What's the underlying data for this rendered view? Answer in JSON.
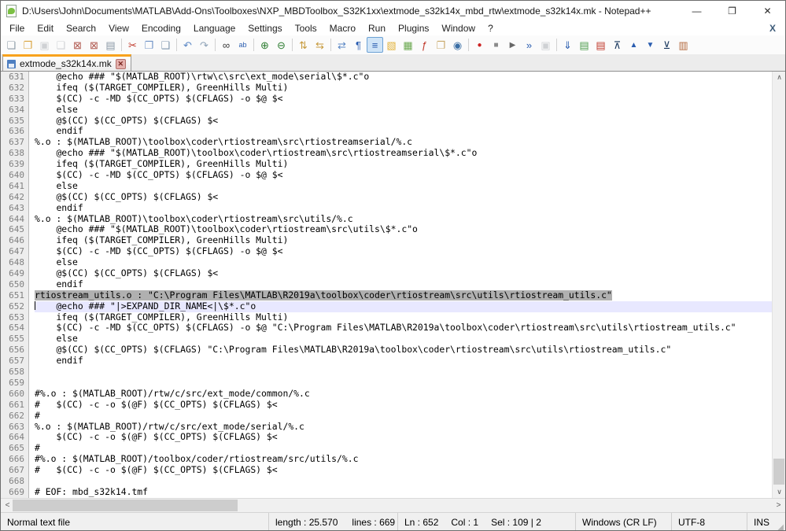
{
  "window": {
    "title": "D:\\Users\\John\\Documents\\MATLAB\\Add-Ons\\Toolboxes\\NXP_MBDToolbox_S32K1xx\\extmode_s32k14x_mbd_rtw\\extmode_s32k14x.mk - Notepad++",
    "controls": {
      "minimize": "—",
      "maximize": "❐",
      "close": "✕"
    }
  },
  "menu": {
    "items": [
      "File",
      "Edit",
      "Search",
      "View",
      "Encoding",
      "Language",
      "Settings",
      "Tools",
      "Macro",
      "Run",
      "Plugins",
      "Window",
      "?"
    ],
    "close_document_x": "X"
  },
  "toolbar": {
    "icons": [
      {
        "name": "new-file-icon",
        "glyph": "❏",
        "color": "#8c9aa6"
      },
      {
        "name": "open-folder-icon",
        "glyph": "❐",
        "color": "#d9a43e"
      },
      {
        "name": "save-icon",
        "glyph": "▣",
        "color": "#7d9cc0",
        "grayed": true
      },
      {
        "name": "save-all-icon",
        "glyph": "❑",
        "color": "#7d9cc0",
        "grayed": true
      },
      {
        "name": "close-icon",
        "glyph": "⊠",
        "color": "#b0584f"
      },
      {
        "name": "close-all-icon",
        "glyph": "⊠",
        "color": "#b0584f"
      },
      {
        "name": "print-icon",
        "glyph": "▤",
        "color": "#8a98a5"
      },
      {
        "name": "cut-icon",
        "glyph": "✂",
        "color": "#c0392b",
        "sep": true
      },
      {
        "name": "copy-icon",
        "glyph": "❐",
        "color": "#6f93c6"
      },
      {
        "name": "paste-icon",
        "glyph": "❑",
        "color": "#7f96ad"
      },
      {
        "name": "undo-icon",
        "glyph": "↶",
        "color": "#5b87c5",
        "sep": true
      },
      {
        "name": "redo-icon",
        "glyph": "↷",
        "color": "#8fa3b8"
      },
      {
        "name": "find-icon",
        "glyph": "∞",
        "color": "#3a3a3a",
        "sep": true
      },
      {
        "name": "replace-icon",
        "glyph": "ab",
        "color": "#2a5db0",
        "fs": 9
      },
      {
        "name": "zoom-in-icon",
        "glyph": "⊕",
        "color": "#2e7d32",
        "sep": true
      },
      {
        "name": "zoom-out-icon",
        "glyph": "⊖",
        "color": "#2e7d32"
      },
      {
        "name": "sync-vertical-icon",
        "glyph": "⇅",
        "color": "#c79a3c",
        "sep": true
      },
      {
        "name": "sync-horizontal-icon",
        "glyph": "⇆",
        "color": "#c79a3c"
      },
      {
        "name": "word-wrap-icon",
        "glyph": "⇄",
        "color": "#5b87c5",
        "sep": true
      },
      {
        "name": "show-all-chars-icon",
        "glyph": "¶",
        "color": "#2a5db0"
      },
      {
        "name": "indent-guide-icon",
        "glyph": "≡",
        "color": "#2a5db0",
        "pressed": true
      },
      {
        "name": "document-map-icon",
        "glyph": "▧",
        "color": "#e2b33c"
      },
      {
        "name": "project-map-icon",
        "glyph": "▦",
        "color": "#6aa84f"
      },
      {
        "name": "function-list-icon",
        "glyph": "ƒ",
        "color": "#c0392b"
      },
      {
        "name": "folder-as-workspace-icon",
        "glyph": "❐",
        "color": "#c9a96a"
      },
      {
        "name": "monitoring-icon",
        "glyph": "◉",
        "color": "#3a6ea5"
      },
      {
        "name": "macro-record-icon",
        "glyph": "●",
        "color": "#cc2222",
        "fs": 10,
        "sep": true
      },
      {
        "name": "macro-stop-icon",
        "glyph": "■",
        "color": "#8a8a8a",
        "fs": 10
      },
      {
        "name": "macro-play-icon",
        "glyph": "▶",
        "color": "#676767",
        "fs": 10
      },
      {
        "name": "macro-run-multiple-icon",
        "glyph": "»",
        "color": "#2a5db0"
      },
      {
        "name": "macro-save-icon",
        "glyph": "▣",
        "color": "#7d9cc0",
        "grayed": true
      },
      {
        "name": "compare-set-first-icon",
        "glyph": "⇓",
        "color": "#2a5db0",
        "sep": true
      },
      {
        "name": "compare-icon",
        "glyph": "▤",
        "color": "#4f9d4f"
      },
      {
        "name": "compare-clear-icon",
        "glyph": "▤",
        "color": "#c0392b"
      },
      {
        "name": "compare-first-diff-icon",
        "glyph": "⊼",
        "color": "#17365d"
      },
      {
        "name": "compare-prev-diff-icon",
        "glyph": "▲",
        "color": "#2a5db0",
        "fs": 10
      },
      {
        "name": "compare-next-diff-icon",
        "glyph": "▼",
        "color": "#2a5db0",
        "fs": 10
      },
      {
        "name": "compare-last-diff-icon",
        "glyph": "⊻",
        "color": "#17365d"
      },
      {
        "name": "compare-nav-bar-icon",
        "glyph": "▥",
        "color": "#b3683c"
      }
    ]
  },
  "tabbar": {
    "tabs": [
      {
        "label": "extmode_s32k14x.mk",
        "active": true,
        "close_glyph": "✕"
      }
    ]
  },
  "editor": {
    "first_line_number": 631,
    "lines": [
      {
        "n": 631,
        "t": "\t@echo ### \"$(MATLAB_ROOT)\\rtw\\c\\src\\ext_mode\\serial\\$*.c\"o",
        "s": ""
      },
      {
        "n": 632,
        "t": "\tifeq ($(TARGET_COMPILER), GreenHills Multi)",
        "s": ""
      },
      {
        "n": 633,
        "t": "\t$(CC) -c -MD $(CC_OPTS) $(CFLAGS) -o $@ $<",
        "s": ""
      },
      {
        "n": 634,
        "t": "\telse",
        "s": ""
      },
      {
        "n": 635,
        "t": "\t@$(CC) $(CC_OPTS) $(CFLAGS) $<",
        "s": ""
      },
      {
        "n": 636,
        "t": "\tendif",
        "s": ""
      },
      {
        "n": 637,
        "t": "%.o : $(MATLAB_ROOT)\\toolbox\\coder\\rtiostream\\src\\rtiostreamserial/%.c",
        "s": ""
      },
      {
        "n": 638,
        "t": "\t@echo ### \"$(MATLAB_ROOT)\\toolbox\\coder\\rtiostream\\src\\rtiostreamserial\\$*.c\"o",
        "s": ""
      },
      {
        "n": 639,
        "t": "\tifeq ($(TARGET_COMPILER), GreenHills Multi)",
        "s": ""
      },
      {
        "n": 640,
        "t": "\t$(CC) -c -MD $(CC_OPTS) $(CFLAGS) -o $@ $<",
        "s": ""
      },
      {
        "n": 641,
        "t": "\telse",
        "s": ""
      },
      {
        "n": 642,
        "t": "\t@$(CC) $(CC_OPTS) $(CFLAGS) $<",
        "s": ""
      },
      {
        "n": 643,
        "t": "\tendif",
        "s": ""
      },
      {
        "n": 644,
        "t": "%.o : $(MATLAB_ROOT)\\toolbox\\coder\\rtiostream\\src\\utils/%.c",
        "s": ""
      },
      {
        "n": 645,
        "t": "\t@echo ### \"$(MATLAB_ROOT)\\toolbox\\coder\\rtiostream\\src\\utils\\$*.c\"o",
        "s": ""
      },
      {
        "n": 646,
        "t": "\tifeq ($(TARGET_COMPILER), GreenHills Multi)",
        "s": ""
      },
      {
        "n": 647,
        "t": "\t$(CC) -c -MD $(CC_OPTS) $(CFLAGS) -o $@ $<",
        "s": ""
      },
      {
        "n": 648,
        "t": "\telse",
        "s": ""
      },
      {
        "n": 649,
        "t": "\t@$(CC) $(CC_OPTS) $(CFLAGS) $<",
        "s": ""
      },
      {
        "n": 650,
        "t": "\tendif",
        "s": ""
      },
      {
        "n": 651,
        "t": "rtiostream_utils.o : \"C:\\Program Files\\MATLAB\\R2019a\\toolbox\\coder\\rtiostream\\src\\utils\\rtiostream_utils.c\"",
        "s": "selected"
      },
      {
        "n": 652,
        "t": "\t@echo ### \"|>EXPAND_DIR_NAME<|\\$*.c\"o",
        "s": "current"
      },
      {
        "n": 653,
        "t": "\tifeq ($(TARGET_COMPILER), GreenHills Multi)",
        "s": ""
      },
      {
        "n": 654,
        "t": "\t$(CC) -c -MD $(CC_OPTS) $(CFLAGS) -o $@ \"C:\\Program Files\\MATLAB\\R2019a\\toolbox\\coder\\rtiostream\\src\\utils\\rtiostream_utils.c\"",
        "s": ""
      },
      {
        "n": 655,
        "t": "\telse",
        "s": ""
      },
      {
        "n": 656,
        "t": "\t@$(CC) $(CC_OPTS) $(CFLAGS) \"C:\\Program Files\\MATLAB\\R2019a\\toolbox\\coder\\rtiostream\\src\\utils\\rtiostream_utils.c\"",
        "s": ""
      },
      {
        "n": 657,
        "t": "\tendif",
        "s": ""
      },
      {
        "n": 658,
        "t": "",
        "s": ""
      },
      {
        "n": 659,
        "t": "",
        "s": ""
      },
      {
        "n": 660,
        "t": "#%.o : $(MATLAB_ROOT)/rtw/c/src/ext_mode/common/%.c",
        "s": ""
      },
      {
        "n": 661,
        "t": "#\t$(CC) -c -o $(@F) $(CC_OPTS) $(CFLAGS) $<",
        "s": ""
      },
      {
        "n": 662,
        "t": "#",
        "s": ""
      },
      {
        "n": 663,
        "t": "%.o : $(MATLAB_ROOT)/rtw/c/src/ext_mode/serial/%.c",
        "s": ""
      },
      {
        "n": 664,
        "t": "\t$(CC) -c -o $(@F) $(CC_OPTS) $(CFLAGS) $<",
        "s": ""
      },
      {
        "n": 665,
        "t": "#",
        "s": ""
      },
      {
        "n": 666,
        "t": "#%.o : $(MATLAB_ROOT)/toolbox/coder/rtiostream/src/utils/%.c",
        "s": ""
      },
      {
        "n": 667,
        "t": "#\t$(CC) -c -o $(@F) $(CC_OPTS) $(CFLAGS) $<",
        "s": ""
      },
      {
        "n": 668,
        "t": "",
        "s": ""
      },
      {
        "n": 669,
        "t": "# EOF: mbd_s32k14.tmf",
        "s": ""
      }
    ]
  },
  "scrollbars": {
    "up": "∧",
    "down": "∨",
    "left": "<",
    "right": ">",
    "grip": "◢"
  },
  "statusbar": {
    "doc_type": "Normal text file",
    "length": "length : 25.570",
    "lines": "lines : 669",
    "ln": "Ln : 652",
    "col": "Col : 1",
    "sel": "Sel : 109 | 2",
    "eol": "Windows (CR LF)",
    "encoding": "UTF-8",
    "insert_mode": "INS"
  }
}
